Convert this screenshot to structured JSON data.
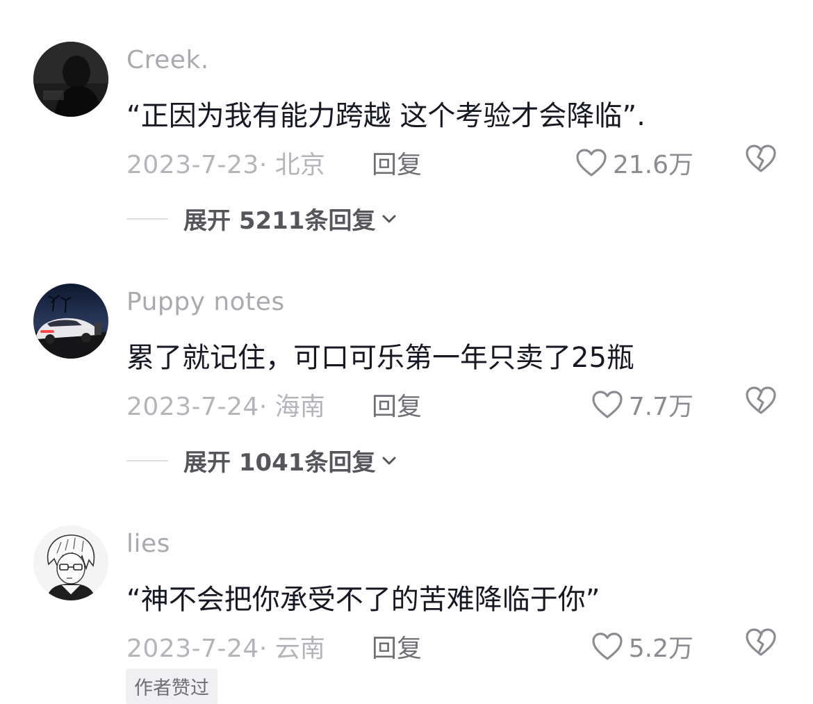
{
  "comments": [
    {
      "username": "Creek.",
      "text": "“正因为我有能力跨越 这个考验才会降临”.",
      "date": "2023-7-23",
      "location": "· 北京",
      "reply_label": "回复",
      "likes": "21.6万",
      "expand_label": "展开 5211条回复",
      "avatar_icon": "dark-portrait-avatar"
    },
    {
      "username": "Puppy notes",
      "text": "累了就记住，可口可乐第一年只卖了25瓶",
      "date": "2023-7-24",
      "location": "· 海南",
      "reply_label": "回复",
      "likes": "7.7万",
      "expand_label": "展开 1041条回复",
      "avatar_icon": "white-sports-car-avatar"
    },
    {
      "username": "lies",
      "text": "“神不会把你承受不了的苦难降临于你”",
      "date": "2023-7-24",
      "location": "· 云南",
      "reply_label": "回复",
      "likes": "5.2万",
      "badge": "作者赞过",
      "avatar_icon": "anime-sketch-boy-avatar"
    }
  ],
  "icons": {
    "like": "heart-outline-icon",
    "dislike": "broken-heart-icon",
    "expand": "chevron-down-icon"
  },
  "colors": {
    "username": "#a9aab0",
    "body_text": "#161823",
    "meta": "#b4b5ba",
    "reply": "#6e6f75",
    "expand": "#55565c"
  }
}
